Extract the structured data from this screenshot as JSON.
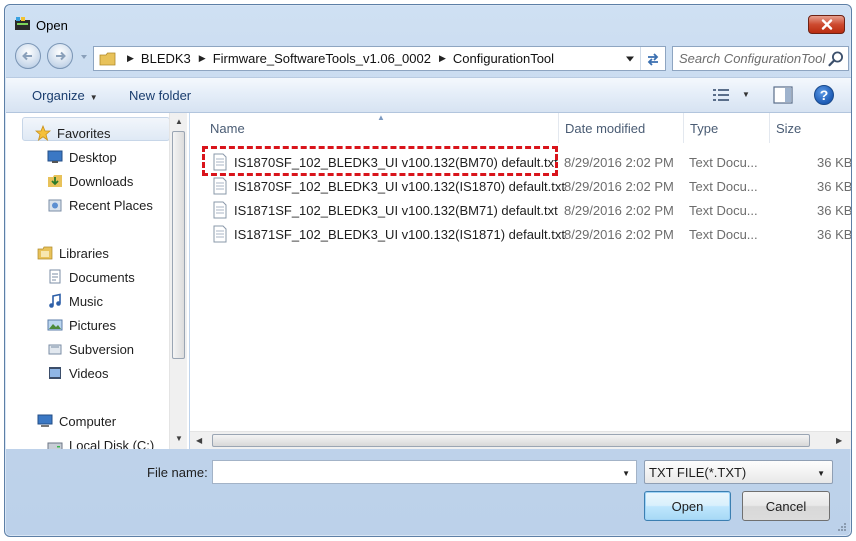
{
  "window": {
    "title": "Open"
  },
  "address": {
    "crumbs": [
      "BLEDK3",
      "Firmware_SoftwareTools_v1.06_0002",
      "ConfigurationTool"
    ]
  },
  "search": {
    "placeholder": "Search ConfigurationTool"
  },
  "toolbar": {
    "organize_label": "Organize",
    "new_folder_label": "New folder"
  },
  "nav": {
    "favorites": {
      "label": "Favorites",
      "items": [
        "Desktop",
        "Downloads",
        "Recent Places"
      ]
    },
    "libraries": {
      "label": "Libraries",
      "items": [
        "Documents",
        "Music",
        "Pictures",
        "Subversion",
        "Videos"
      ]
    },
    "computer": {
      "label": "Computer",
      "items": [
        "Local Disk (C:)"
      ]
    }
  },
  "columns": {
    "name": "Name",
    "date": "Date modified",
    "type": "Type",
    "size": "Size"
  },
  "files": [
    {
      "name": "IS1870SF_102_BLEDK3_UI v100.132(BM70) default.txt",
      "date": "8/29/2016 2:02 PM",
      "type": "Text Docu...",
      "size": "36 KB"
    },
    {
      "name": "IS1870SF_102_BLEDK3_UI v100.132(IS1870) default.txt",
      "date": "8/29/2016 2:02 PM",
      "type": "Text Docu...",
      "size": "36 KB"
    },
    {
      "name": "IS1871SF_102_BLEDK3_UI v100.132(BM71) default.txt",
      "date": "8/29/2016 2:02 PM",
      "type": "Text Docu...",
      "size": "36 KB"
    },
    {
      "name": "IS1871SF_102_BLEDK3_UI v100.132(IS1871) default.txt",
      "date": "8/29/2016 2:02 PM",
      "type": "Text Docu...",
      "size": "36 KB"
    }
  ],
  "footer": {
    "file_name_label": "File name:",
    "file_name_value": "",
    "filter_value": "TXT FILE(*.TXT)",
    "open_label": "Open",
    "cancel_label": "Cancel"
  },
  "colors": {
    "highlight": "#d9141b",
    "accent": "#1a3d6e"
  }
}
